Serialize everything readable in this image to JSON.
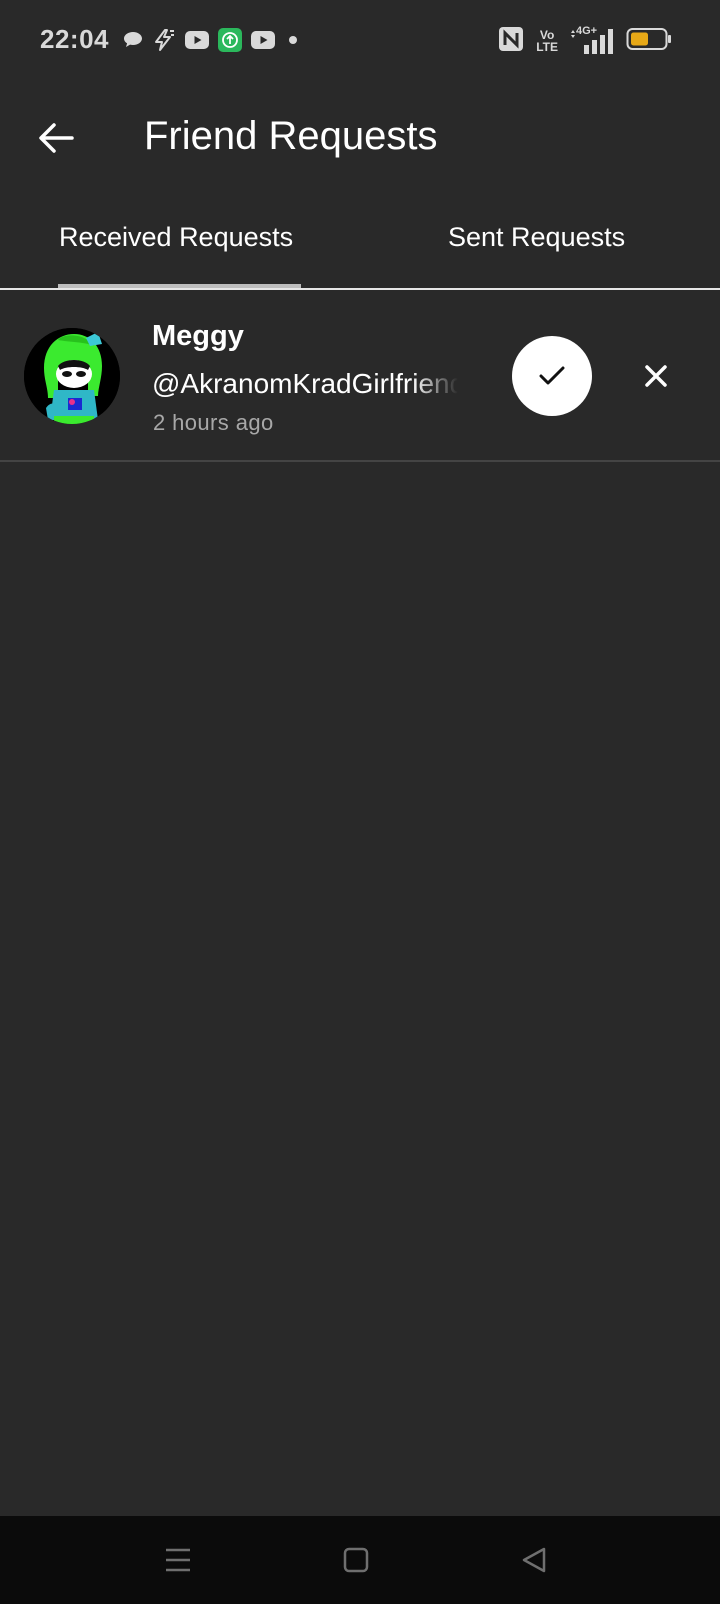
{
  "status_bar": {
    "time": "22:04",
    "left_icons": [
      "chat-bubble-icon",
      "zap-icon",
      "youtube-icon",
      "upload-app-icon",
      "youtube-icon",
      "dot-icon"
    ],
    "right_icons": [
      "nfc-icon",
      "volte-icon",
      "signal-4g-icon",
      "battery-icon"
    ],
    "volte_top": "Vo",
    "volte_bottom": "LTE",
    "network": "4G+",
    "battery_level": 0.45,
    "battery_color": "#e6a817",
    "upload_app_color": "#2bb85c"
  },
  "header": {
    "title": "Friend Requests",
    "back_icon": "arrow-left-icon"
  },
  "tabs": [
    {
      "label": "Received Requests",
      "active": true
    },
    {
      "label": "Sent Requests",
      "active": false
    }
  ],
  "requests": [
    {
      "name": "Meggy",
      "handle": "@AkranomKradGirlfriend",
      "time": "2 hours ago",
      "accept_icon": "check-icon",
      "decline_icon": "close-icon"
    }
  ],
  "nav_bar": {
    "icons": [
      "menu-icon",
      "home-square-icon",
      "back-triangle-icon"
    ]
  },
  "colors": {
    "background": "#292929",
    "text": "#ffffff",
    "secondary_text": "#a8a8a8",
    "nav_background": "#0b0b0b"
  }
}
